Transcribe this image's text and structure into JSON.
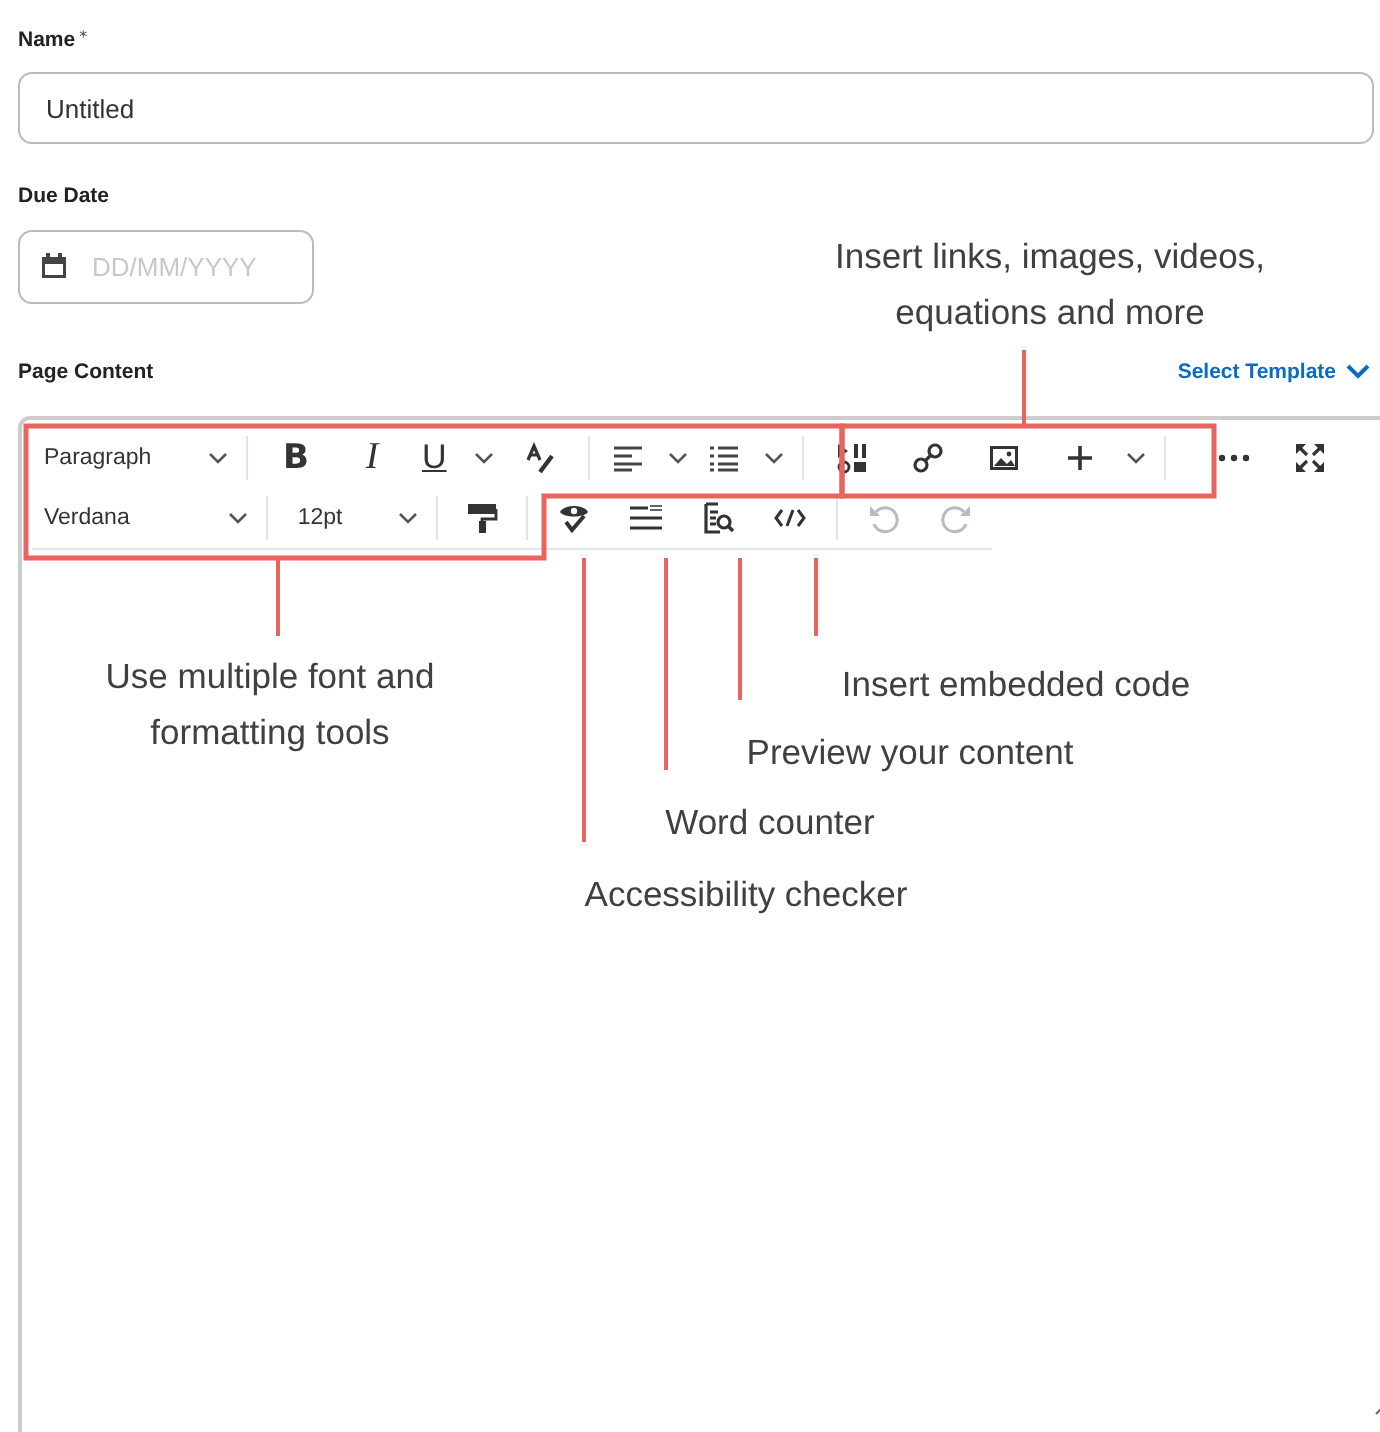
{
  "name_field": {
    "label": "Name",
    "required_mark": "*",
    "value": "Untitled"
  },
  "due_date": {
    "label": "Due Date",
    "placeholder": "DD/MM/YYYY"
  },
  "page_content": {
    "label": "Page Content",
    "select_template": "Select Template"
  },
  "toolbar": {
    "format_dropdown": "Paragraph",
    "bold": "B",
    "italic": "I",
    "underline": "U",
    "font_dropdown": "Verdana",
    "size_dropdown": "12pt",
    "undo": {
      "disabled": true
    },
    "redo": {
      "disabled": true
    }
  },
  "callouts": [
    {
      "kind": "insert",
      "text": "Insert links, images, videos, equations and more"
    },
    {
      "kind": "format",
      "text": "Use multiple font and formatting tools"
    },
    {
      "kind": "code",
      "text": "Insert embedded code"
    },
    {
      "kind": "preview",
      "text": "Preview your content"
    },
    {
      "kind": "counter",
      "text": "Word counter"
    },
    {
      "kind": "a11y",
      "text": "Accessibility checker"
    }
  ]
}
